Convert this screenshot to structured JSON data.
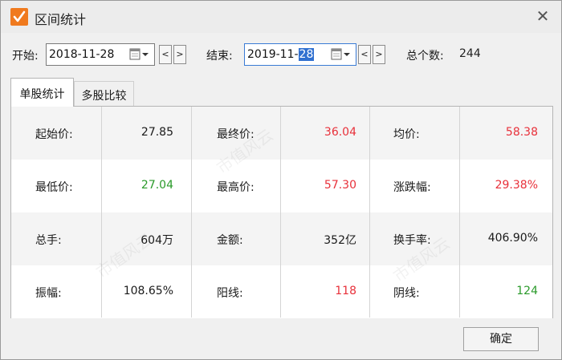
{
  "window": {
    "title": "区间统计",
    "close_glyph": "✕"
  },
  "range": {
    "start_label": "开始:",
    "start_date": "2018-11-28",
    "end_label": "结束:",
    "end_date_prefix": "2019-11-",
    "end_date_selected": "28",
    "count_label": "总个数:",
    "count_value": "244",
    "prev_glyph": "<",
    "next_glyph": ">"
  },
  "tabs": [
    {
      "label": "单股统计",
      "active": true
    },
    {
      "label": "多股比较",
      "active": false
    }
  ],
  "stats": {
    "rows": [
      [
        {
          "label": "起始价:",
          "value": "27.85",
          "color": "#1a1a1a"
        },
        {
          "label": "最终价:",
          "value": "36.04",
          "color": "#e8303a"
        },
        {
          "label": "均价:",
          "value": "58.38",
          "color": "#e8303a"
        }
      ],
      [
        {
          "label": "最低价:",
          "value": "27.04",
          "color": "#2a9a2a"
        },
        {
          "label": "最高价:",
          "value": "57.30",
          "color": "#e8303a"
        },
        {
          "label": "涨跌幅:",
          "value": "29.38%",
          "color": "#e8303a"
        }
      ],
      [
        {
          "label": "总手:",
          "value": "604万",
          "color": "#1a1a1a"
        },
        {
          "label": "金额:",
          "value": "352亿",
          "color": "#1a1a1a"
        },
        {
          "label": "换手率:",
          "value": "406.90%",
          "color": "#1a1a1a"
        }
      ],
      [
        {
          "label": "振幅:",
          "value": "108.65%",
          "color": "#1a1a1a"
        },
        {
          "label": "阳线:",
          "value": "118",
          "color": "#e8303a"
        },
        {
          "label": "阴线:",
          "value": "124",
          "color": "#2a9a2a"
        }
      ]
    ]
  },
  "watermark_text": "市值风云",
  "footer": {
    "ok_label": "确定"
  },
  "colors": {
    "accent": "#f07a1e",
    "up": "#e8303a",
    "down": "#2a9a2a",
    "selection": "#3070d0"
  },
  "icons": {
    "app": "checkmark-icon",
    "close": "close-icon",
    "calendar": "calendar-dropdown-icon"
  }
}
